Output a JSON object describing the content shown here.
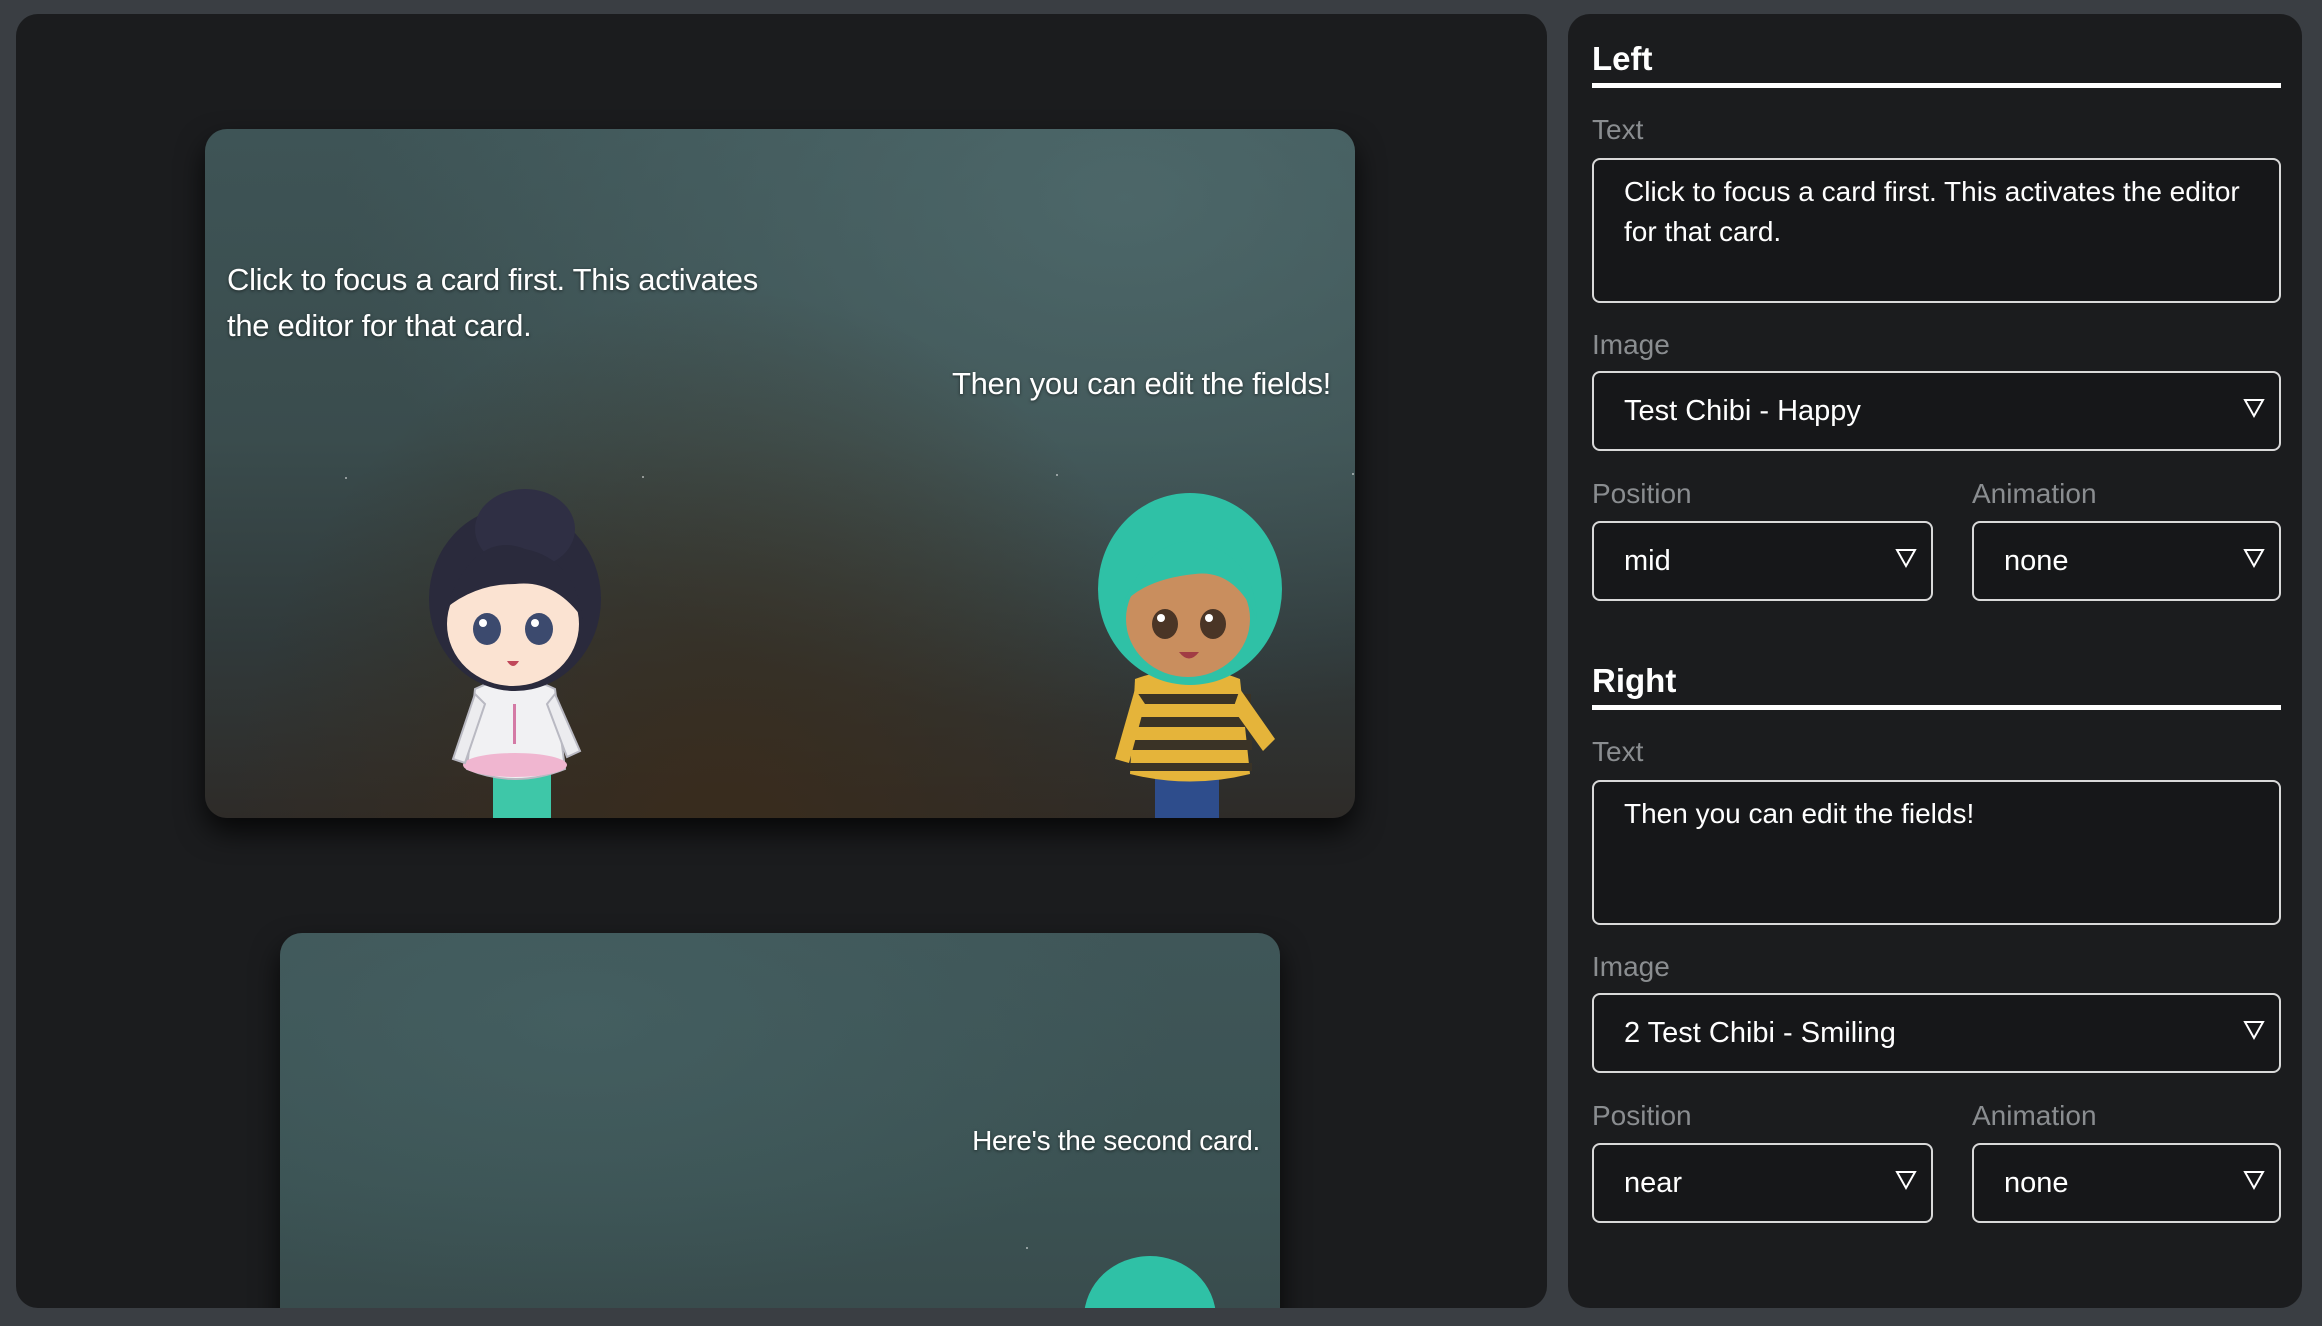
{
  "cards": [
    {
      "left_text": "Click to focus a card first. This activates the editor for that card.",
      "right_text": "Then you can edit the fields!"
    },
    {
      "right_text": "Here's the second card."
    }
  ],
  "editor": {
    "left": {
      "heading": "Left",
      "text_label": "Text",
      "text_value": "Click to focus a card first. This activates the editor for that card.",
      "image_label": "Image",
      "image_value": "Test Chibi - Happy",
      "position_label": "Position",
      "position_value": "mid",
      "animation_label": "Animation",
      "animation_value": "none"
    },
    "right": {
      "heading": "Right",
      "text_label": "Text",
      "text_value": "Then you can edit the fields!",
      "image_label": "Image",
      "image_value": "2 Test Chibi - Smiling",
      "position_label": "Position",
      "position_value": "near",
      "animation_label": "Animation",
      "animation_value": "none"
    }
  },
  "colors": {
    "page_bg": "#3a3e43",
    "panel_bg": "#1b1c1e",
    "label_gray": "#8a8d90",
    "accent_white": "#ffffff"
  },
  "icons": {
    "dropdown": "triangle-down-outline-icon"
  }
}
